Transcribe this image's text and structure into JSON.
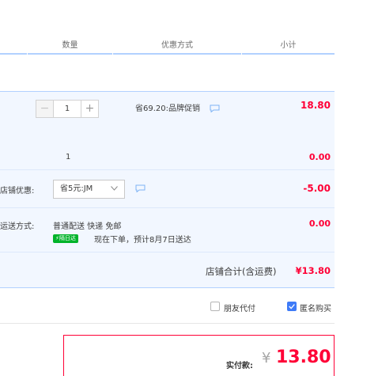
{
  "header": {
    "quantity": "数量",
    "discount": "优惠方式",
    "subtotal": "小计"
  },
  "item": {
    "quantity_value": "1",
    "minus": "−",
    "plus": "+",
    "promo": "省69.20:品牌促销",
    "price": "18.80"
  },
  "gift": {
    "quantity": "1",
    "price": "0.00"
  },
  "shop_coupon": {
    "label": "店铺优惠:",
    "selected": "省5元:JM",
    "amount": "-5.00"
  },
  "shipping": {
    "label": "运送方式:",
    "method": "普通配送 快递 免邮",
    "badge": "隔日达",
    "eta": "现在下单，预计8月7日送达",
    "price": "0.00"
  },
  "shop_total": {
    "label": "店铺合计(含运费)",
    "value": "¥13.80"
  },
  "options": {
    "friend_pay": "朋友代付",
    "anonymous": "匿名购买",
    "anonymous_checked": true,
    "friend_pay_checked": false
  },
  "payment": {
    "label": "实付款:",
    "currency": "¥",
    "amount": "13.80"
  },
  "colors": {
    "accent_red": "#ff0036",
    "accent_blue": "#3e7bf7",
    "row_bg": "#f2f7ff",
    "badge_green": "#00b32a"
  }
}
